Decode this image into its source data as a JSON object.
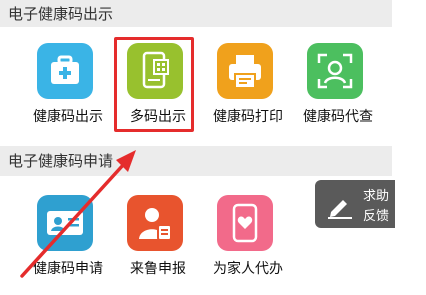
{
  "sections": [
    {
      "title": "电子健康码出示",
      "items": [
        {
          "label": "健康码出示",
          "icon": "medical-kit-icon",
          "color": "#3ab4e6"
        },
        {
          "label": "多码出示",
          "icon": "multi-qr-phone-icon",
          "color": "#98c12e"
        },
        {
          "label": "健康码打印",
          "icon": "printer-icon",
          "color": "#f0a11c"
        },
        {
          "label": "健康码代查",
          "icon": "face-scan-icon",
          "color": "#4cbf5f"
        }
      ]
    },
    {
      "title": "电子健康码申请",
      "items": [
        {
          "label": "健康码申请",
          "icon": "id-card-icon",
          "color": "#2fa0d0"
        },
        {
          "label": "来鲁申报",
          "icon": "person-report-icon",
          "color": "#e8542e"
        },
        {
          "label": "为家人代办",
          "icon": "phone-heart-icon",
          "color": "#f26a8a"
        }
      ]
    }
  ],
  "help_button": {
    "line1": "求助",
    "line2": "反馈",
    "icon": "pencil-icon"
  },
  "colors": {
    "highlight": "#e52c2c",
    "arrow": "#e52c2c"
  }
}
